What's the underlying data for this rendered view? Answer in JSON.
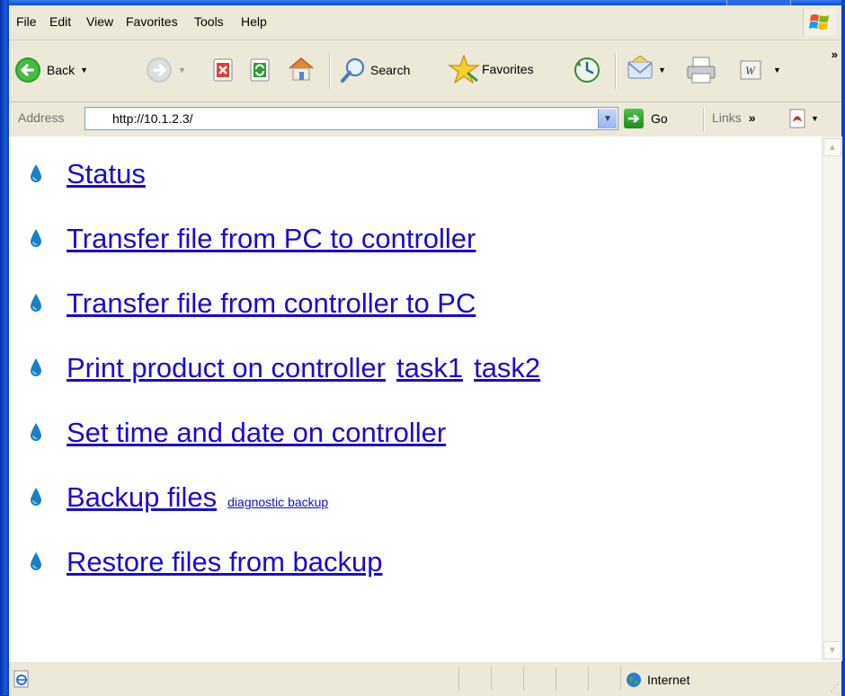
{
  "menu": {
    "file": "File",
    "edit": "Edit",
    "view": "View",
    "favorites": "Favorites",
    "tools": "Tools",
    "help": "Help"
  },
  "toolbar": {
    "back_label": "Back",
    "search_label": "Search",
    "favorites_label": "Favorites",
    "overflow": "»"
  },
  "address": {
    "label": "Address",
    "url": "http://10.1.2.3/",
    "go_label": "Go",
    "links_label": "Links",
    "links_overflow": "»"
  },
  "nav": {
    "status": "Status",
    "transfer_pc_to_controller": "Transfer file from PC to controller",
    "transfer_controller_to_pc": "Transfer file from controller to PC",
    "print_product": "Print product on controller",
    "task1": "task1",
    "task2": "task2",
    "set_time_date": "Set time and date on controller",
    "backup_files": "Backup files",
    "diagnostic_backup": "diagnostic backup",
    "restore_files": "Restore files from backup"
  },
  "status": {
    "zone": "Internet"
  },
  "colors": {
    "link": "#1a0ccc",
    "chrome": "#ece9d8",
    "frame": "#0a3fb8"
  }
}
